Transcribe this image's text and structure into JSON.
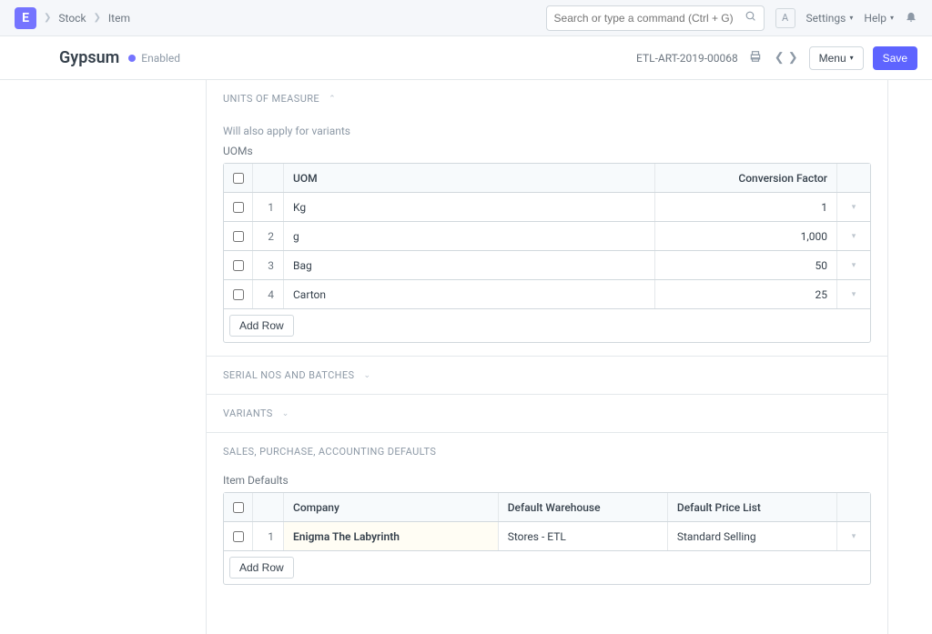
{
  "navbar": {
    "logo": "E",
    "breadcrumbs": [
      "Stock",
      "Item"
    ],
    "search_placeholder": "Search or type a command (Ctrl + G)",
    "avatar_initial": "A",
    "settings_label": "Settings",
    "help_label": "Help"
  },
  "header": {
    "title": "Gypsum",
    "status": "Enabled",
    "doc_id": "ETL-ART-2019-00068",
    "menu_label": "Menu",
    "save_label": "Save"
  },
  "sections": {
    "uom": {
      "title": "Units of Measure",
      "hint": "Will also apply for variants",
      "field_label": "UOMs",
      "columns": {
        "uom": "UOM",
        "conv": "Conversion Factor"
      },
      "rows": [
        {
          "idx": "1",
          "uom": "Kg",
          "conv": "1"
        },
        {
          "idx": "2",
          "uom": "g",
          "conv": "1,000"
        },
        {
          "idx": "3",
          "uom": "Bag",
          "conv": "50"
        },
        {
          "idx": "4",
          "uom": "Carton",
          "conv": "25"
        }
      ],
      "add_row": "Add Row"
    },
    "serial": {
      "title": "Serial Nos and Batches"
    },
    "variants": {
      "title": "Variants"
    },
    "defaults": {
      "title": "Sales, Purchase, Accounting Defaults",
      "field_label": "Item Defaults",
      "columns": {
        "company": "Company",
        "wh": "Default Warehouse",
        "pl": "Default Price List"
      },
      "rows": [
        {
          "idx": "1",
          "company": "Enigma The Labyrinth",
          "wh": "Stores - ETL",
          "pl": "Standard Selling"
        }
      ],
      "add_row": "Add Row"
    }
  }
}
